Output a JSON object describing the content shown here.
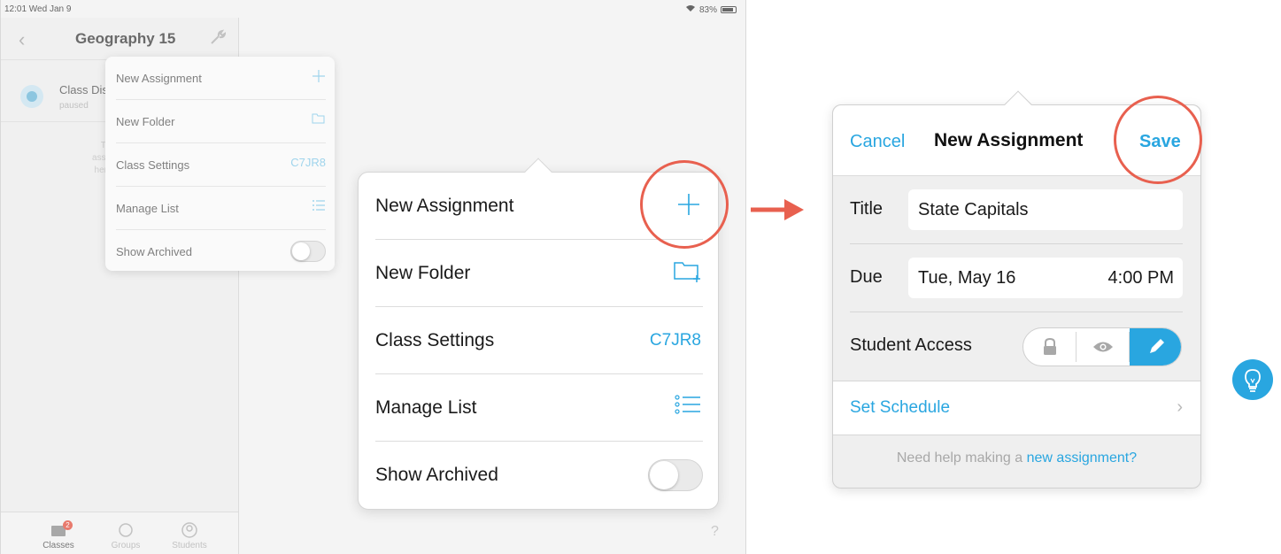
{
  "status_bar": {
    "time": "12:01  Wed Jan 9",
    "battery": "83%"
  },
  "sidebar": {
    "title": "Geography 15",
    "row": {
      "name": "Class Dis",
      "sub": "paused"
    },
    "empty_text": [
      "This class",
      "assignments y",
      "here to share"
    ],
    "tabs": [
      {
        "label": "Classes",
        "badge": "2"
      },
      {
        "label": "Groups"
      },
      {
        "label": "Students"
      }
    ]
  },
  "small_menu": {
    "items": [
      {
        "label": "New Assignment",
        "icon": "plus-icon"
      },
      {
        "label": "New Folder",
        "icon": "folder-plus-icon"
      },
      {
        "label": "Class Settings",
        "code": "C7JR8"
      },
      {
        "label": "Manage List",
        "icon": "list-icon"
      },
      {
        "label": "Show Archived",
        "toggle": false
      }
    ]
  },
  "big_menu": {
    "items": [
      {
        "label": "New Assignment",
        "icon": "plus-icon"
      },
      {
        "label": "New Folder",
        "icon": "folder-plus-icon"
      },
      {
        "label": "Class Settings",
        "code": "C7JR8"
      },
      {
        "label": "Manage List",
        "icon": "list-icon"
      },
      {
        "label": "Show Archived",
        "toggle": false
      }
    ]
  },
  "help_glyph": "?",
  "form": {
    "cancel": "Cancel",
    "title": "New Assignment",
    "save": "Save",
    "title_label": "Title",
    "title_value": "State Capitals",
    "due_label": "Due",
    "due_date": "Tue, May 16",
    "due_time": "4:00 PM",
    "access_label": "Student Access",
    "access_options": [
      "lock-icon",
      "eye-icon",
      "pencil-icon"
    ],
    "access_selected": "pencil-icon",
    "schedule": "Set Schedule",
    "help_prefix": "Need help making a ",
    "help_link": "new assignment?"
  },
  "colors": {
    "accent": "#29a6e0",
    "highlight": "#e8604f"
  }
}
